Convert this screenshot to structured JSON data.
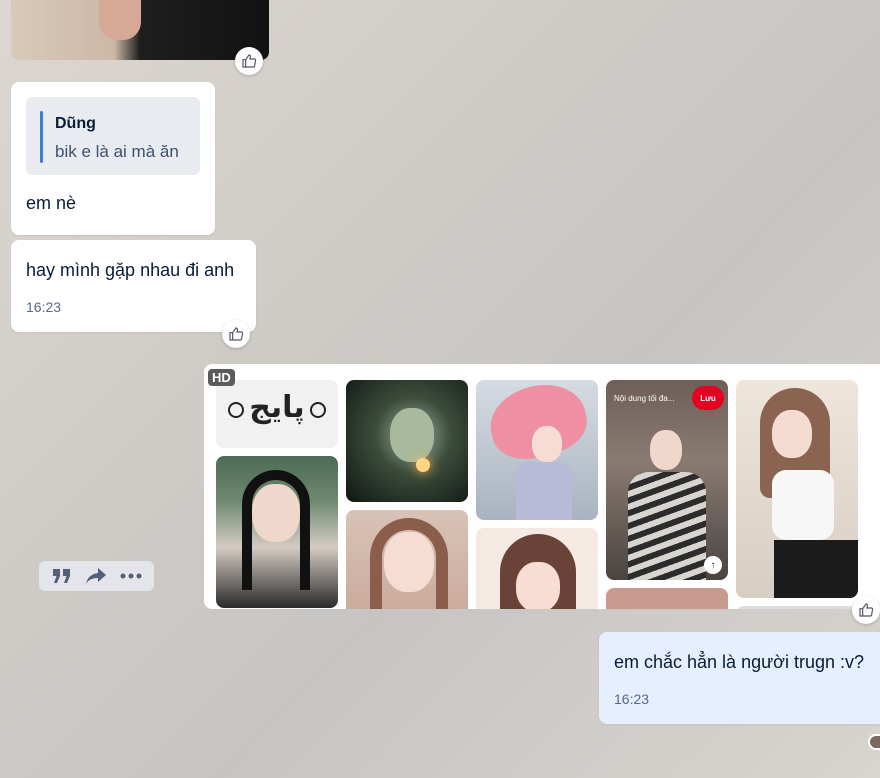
{
  "messages": {
    "quoted": {
      "author": "Dũng",
      "text": "bik e là ai mà ăn"
    },
    "reply_text": "em nè",
    "second_text": "hay mình gặp nhau đi anh",
    "second_time": "16:23",
    "mine_text": "em chắc hẳn là người trugn :v?",
    "mine_time": "16:23"
  },
  "image": {
    "badge": "HD",
    "logo_text": "پایج",
    "pin_header": "Nội dung tối đa...",
    "pin_save": "Lưu"
  },
  "icons": {
    "reaction": "thumbs-up-icon",
    "toolbar": [
      "quote-icon",
      "forward-icon",
      "more-icon"
    ]
  },
  "colors": {
    "bubble_other": "#ffffff",
    "bubble_mine": "#e5efff",
    "quote_bar": "#3b7dd8",
    "pin_save": "#e60023"
  }
}
